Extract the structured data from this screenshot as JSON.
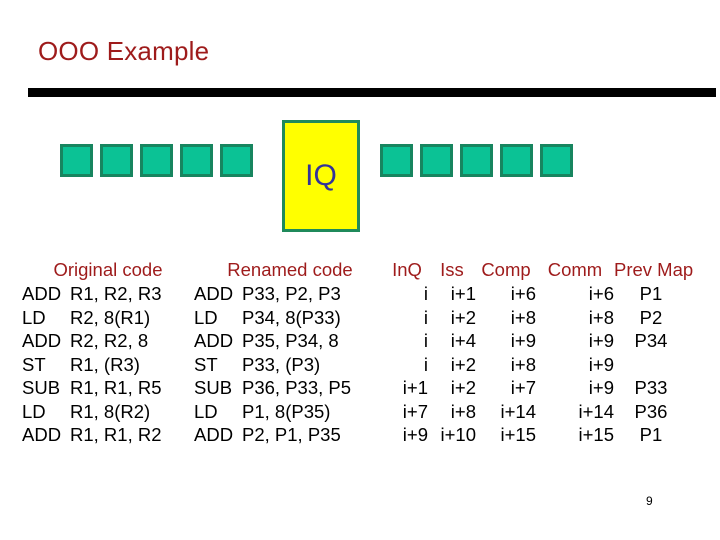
{
  "slide": {
    "title": "OOO Example",
    "page_number": "9"
  },
  "colors": {
    "title_red": "#9E1B1B",
    "rule_black": "#000000",
    "square_fill": "#0BC295",
    "square_border": "#17855F",
    "iq_fill": "#FFFF00",
    "iq_border": "#1F8A5B",
    "iq_text": "#333399",
    "body_text": "#000000"
  },
  "pipeline": {
    "left_squares": [
      "square",
      "square",
      "square",
      "square",
      "square"
    ],
    "right_squares": [
      "square",
      "square",
      "square",
      "square",
      "square"
    ],
    "iq_label": "IQ"
  },
  "headers": {
    "original": "Original code",
    "renamed": "Renamed code",
    "inq": "InQ",
    "iss": "Iss",
    "comp": "Comp",
    "comm": "Comm",
    "prev_map": "Prev Map"
  },
  "rows": [
    {
      "orig_op": "ADD",
      "orig_args": "R1, R2, R3",
      "ren_op": "ADD",
      "ren_args": "P33, P2, P3",
      "inq": "i",
      "iss": "i+1",
      "comp": "i+6",
      "comm": "i+6",
      "prev": "P1"
    },
    {
      "orig_op": "LD",
      "orig_args": "R2, 8(R1)",
      "ren_op": "LD",
      "ren_args": "P34, 8(P33)",
      "inq": "i",
      "iss": "i+2",
      "comp": "i+8",
      "comm": "i+8",
      "prev": "P2"
    },
    {
      "orig_op": "ADD",
      "orig_args": "R2, R2, 8",
      "ren_op": "ADD",
      "ren_args": "P35, P34, 8",
      "inq": "i",
      "iss": "i+4",
      "comp": "i+9",
      "comm": "i+9",
      "prev": "P34"
    },
    {
      "orig_op": "ST",
      "orig_args": "R1, (R3)",
      "ren_op": "ST",
      "ren_args": "P33, (P3)",
      "inq": "i",
      "iss": "i+2",
      "comp": "i+8",
      "comm": "i+9",
      "prev": ""
    },
    {
      "orig_op": "SUB",
      "orig_args": "R1, R1, R5",
      "ren_op": "SUB",
      "ren_args": "P36, P33, P5",
      "inq": "i+1",
      "iss": "i+2",
      "comp": "i+7",
      "comm": "i+9",
      "prev": "P33"
    },
    {
      "orig_op": "LD",
      "orig_args": "R1, 8(R2)",
      "ren_op": "LD",
      "ren_args": "P1, 8(P35)",
      "inq": "i+7",
      "iss": "i+8",
      "comp": "i+14",
      "comm": "i+14",
      "prev": "P36"
    },
    {
      "orig_op": "ADD",
      "orig_args": "R1, R1, R2",
      "ren_op": "ADD",
      "ren_args": "P2, P1, P35",
      "inq": "i+9",
      "iss": "i+10",
      "comp": "i+15",
      "comm": "i+15",
      "prev": "P1"
    }
  ]
}
